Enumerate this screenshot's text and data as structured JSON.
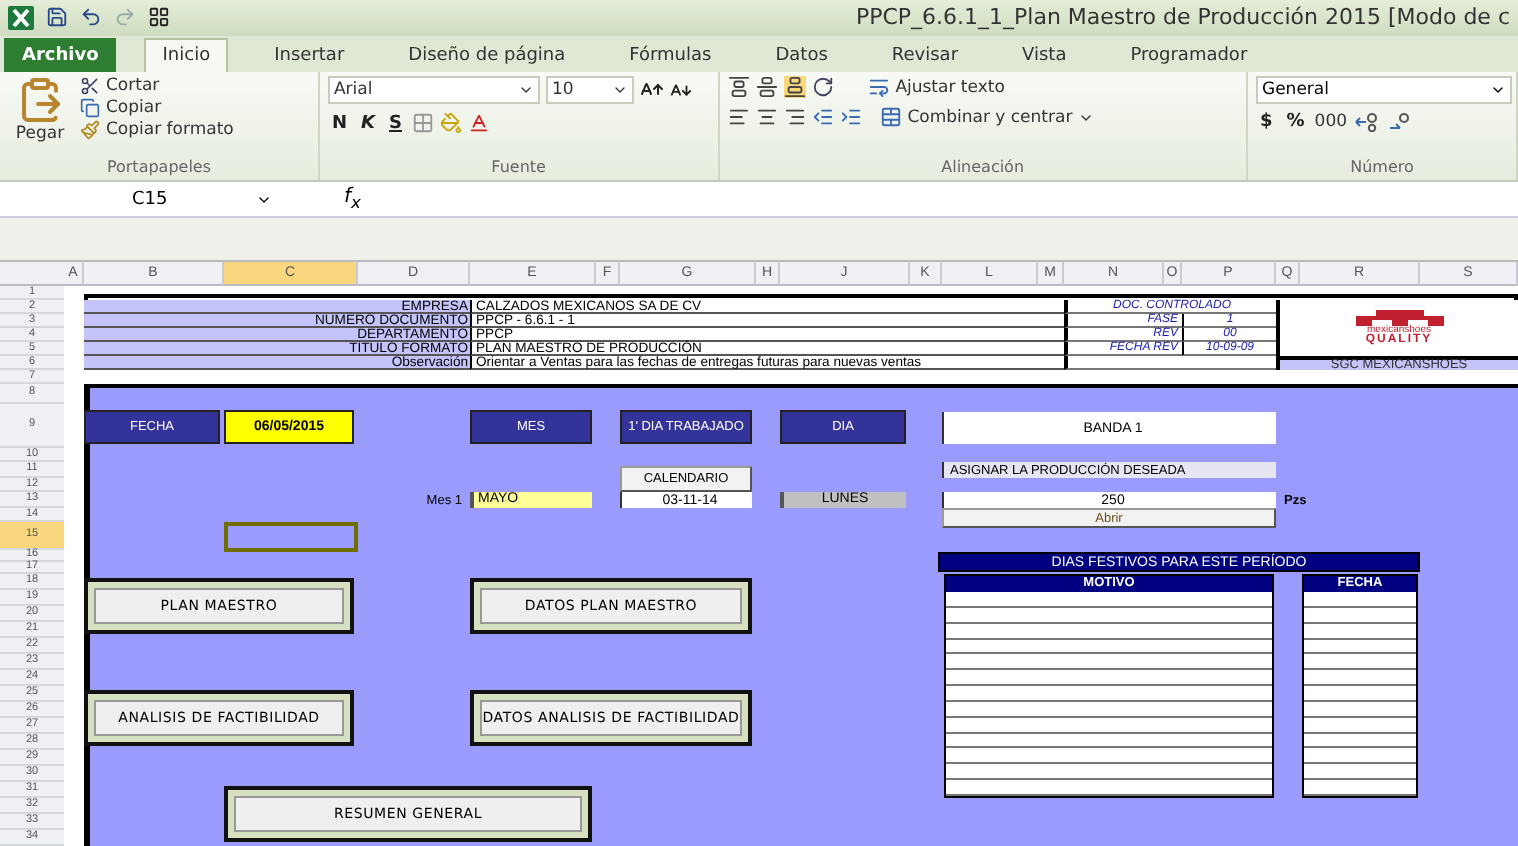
{
  "title_bar": {
    "title": "PPCP_6.6.1_1_Plan Maestro de Producción 2015  [Modo de c"
  },
  "ribbon_tabs": [
    {
      "label": "Archivo",
      "kind": "file",
      "selected": false
    },
    {
      "label": "Inicio",
      "kind": "tab",
      "selected": true
    },
    {
      "label": "Insertar",
      "kind": "tab",
      "selected": false
    },
    {
      "label": "Diseño de página",
      "kind": "tab",
      "selected": false
    },
    {
      "label": "Fórmulas",
      "kind": "tab",
      "selected": false
    },
    {
      "label": "Datos",
      "kind": "tab",
      "selected": false
    },
    {
      "label": "Revisar",
      "kind": "tab",
      "selected": false
    },
    {
      "label": "Vista",
      "kind": "tab",
      "selected": false
    },
    {
      "label": "Programador",
      "kind": "tab",
      "selected": false
    }
  ],
  "clipboard": {
    "paste": "Pegar",
    "cut": "Cortar",
    "copy": "Copiar",
    "format_painter": "Copiar formato",
    "group_label": "Portapapeles"
  },
  "font": {
    "name": "Arial",
    "size": "10",
    "bold": "N",
    "italic": "K",
    "underline": "S",
    "group_label": "Fuente"
  },
  "alignment": {
    "wrap": "Ajustar texto",
    "merge": "Combinar y centrar",
    "group_label": "Alineación"
  },
  "number": {
    "format": "General",
    "currency": "$",
    "percent": "%",
    "thousands": "000",
    "group_label": "Número"
  },
  "formula_bar": {
    "name_box": "C15",
    "fx": "f$_{x}$"
  },
  "columns": [
    {
      "label": "A",
      "selected": false
    },
    {
      "label": "B",
      "selected": false
    },
    {
      "label": "C",
      "selected": true
    },
    {
      "label": "D",
      "selected": false
    },
    {
      "label": "E",
      "selected": false
    },
    {
      "label": "F",
      "selected": false
    },
    {
      "label": "G",
      "selected": false
    },
    {
      "label": "H",
      "selected": false
    },
    {
      "label": "J",
      "selected": false
    },
    {
      "label": "K",
      "selected": false
    },
    {
      "label": "L",
      "selected": false
    },
    {
      "label": "M",
      "selected": false
    },
    {
      "label": "N",
      "selected": false
    },
    {
      "label": "O",
      "selected": false
    },
    {
      "label": "P",
      "selected": false
    },
    {
      "label": "Q",
      "selected": false
    },
    {
      "label": "R",
      "selected": false
    },
    {
      "label": "S",
      "selected": false
    }
  ],
  "rows": [
    {
      "label": "1",
      "selected": false
    },
    {
      "label": "2",
      "selected": false
    },
    {
      "label": "3",
      "selected": false
    },
    {
      "label": "4",
      "selected": false
    },
    {
      "label": "5",
      "selected": false
    },
    {
      "label": "6",
      "selected": false
    },
    {
      "label": "7",
      "selected": false
    },
    {
      "label": "8",
      "selected": false
    },
    {
      "label": "9",
      "selected": false
    },
    {
      "label": "10",
      "selected": false
    },
    {
      "label": "11",
      "selected": false
    },
    {
      "label": "12",
      "selected": false
    },
    {
      "label": "13",
      "selected": false
    },
    {
      "label": "14",
      "selected": false
    },
    {
      "label": "15",
      "selected": true
    },
    {
      "label": "16",
      "selected": false
    },
    {
      "label": "17",
      "selected": false
    },
    {
      "label": "18",
      "selected": false
    },
    {
      "label": "19",
      "selected": false
    },
    {
      "label": "20",
      "selected": false
    },
    {
      "label": "21",
      "selected": false
    },
    {
      "label": "22",
      "selected": false
    },
    {
      "label": "23",
      "selected": false
    },
    {
      "label": "24",
      "selected": false
    },
    {
      "label": "25",
      "selected": false
    },
    {
      "label": "26",
      "selected": false
    },
    {
      "label": "27",
      "selected": false
    },
    {
      "label": "28",
      "selected": false
    },
    {
      "label": "29",
      "selected": false
    },
    {
      "label": "30",
      "selected": false
    },
    {
      "label": "31",
      "selected": false
    },
    {
      "label": "32",
      "selected": false
    },
    {
      "label": "33",
      "selected": false
    },
    {
      "label": "34",
      "selected": false
    }
  ],
  "header_block": {
    "fields": [
      {
        "label": "EMPRESA",
        "value": "CALZADOS MEXICANOS SA DE CV"
      },
      {
        "label": "NUMERO DOCUMENTO",
        "value": "PPCP - 6.6.1 - 1"
      },
      {
        "label": "DEPARTAMENTO",
        "value": "PPCP"
      },
      {
        "label": "TITULO FORMATO",
        "value": "PLAN MAESTRO DE PRODUCCIÓN"
      },
      {
        "label": "Observación",
        "value": "Orientar a Ventas para las fechas de entregas futuras para nuevas ventas"
      }
    ],
    "doc_title": "DOC. CONTROLADO",
    "doc_rows": [
      {
        "label": "FASE",
        "value": "1"
      },
      {
        "label": "REV",
        "value": "00"
      },
      {
        "label": "FECHA REV",
        "value": "10-09-09"
      }
    ],
    "logo": {
      "line1": "mexicanshoes",
      "line2": "QUALITY"
    },
    "system": "SGC MEXICANSHOES"
  },
  "form": {
    "fecha_label": "FECHA",
    "fecha_value": "06/05/2015",
    "mes_label": "MES",
    "first_day_label": "1' DIA TRABAJADO",
    "dia_label": "DIA",
    "banda": "BANDA 1",
    "calendario": "CALENDARIO",
    "asignar": "ASIGNAR LA PRODUCCIÓN DESEADA",
    "mes_caption": "Mes 1",
    "mes_value": "MAYO",
    "first_day_value": "03-11-14",
    "dia_value": "LUNES",
    "production": "250",
    "unit": "Pzs",
    "abrir": "Abrir"
  },
  "holidays": {
    "title": "DIAS FESTIVOS PARA ESTE PERÍODO",
    "columns": [
      "MOTIVO",
      "FECHA"
    ]
  },
  "macro_buttons": [
    {
      "label": "PLAN MAESTRO"
    },
    {
      "label": "DATOS PLAN MAESTRO"
    },
    {
      "label": "ANALISIS DE FACTIBILIDAD"
    },
    {
      "label": "DATOS ANALISIS DE FACTIBILIDAD"
    },
    {
      "label": "RESUMEN GENERAL"
    }
  ]
}
